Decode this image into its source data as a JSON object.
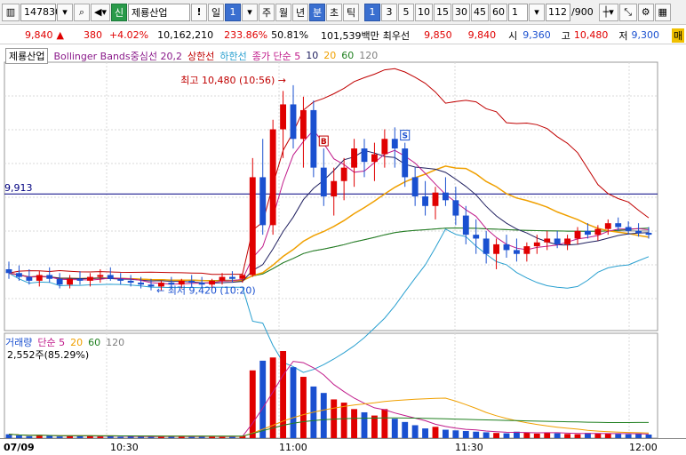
{
  "toolbar": {
    "code": "147830",
    "credit_badge": "신",
    "stock_name": "제룡산업",
    "exclaim": "!",
    "period_day": "일",
    "period_num": "1",
    "week": "주",
    "month": "월",
    "year": "년",
    "minute": "분",
    "second": "초",
    "tick": "틱",
    "intervals": [
      "1",
      "3",
      "5",
      "10",
      "15",
      "30",
      "45",
      "60"
    ],
    "active_interval": "1",
    "custom_interval": "1",
    "count": "112",
    "count_total": "/900"
  },
  "info": {
    "price": "9,840",
    "arrow": "▲",
    "change": "380",
    "change_pct": "+4.02%",
    "volume": "10,162,210",
    "vol_ratio": "233.86%",
    "strength": "50.81%",
    "amount": "101,539백만",
    "best_ask_label": "최우선",
    "best_ask": "9,850",
    "best_bid": "9,840",
    "open_label": "시",
    "open": "9,360",
    "high_label": "고",
    "high": "10,480",
    "low_label": "저",
    "low": "9,300",
    "more": "매"
  },
  "price_legend": {
    "name": "제룡산업",
    "bb": "Bollinger Bands중심선 20,2",
    "upper": "상한선",
    "lower": "하한선",
    "ma_label": "종가 단순 5",
    "ma10": "10",
    "ma20": "20",
    "ma60": "60",
    "ma120": "120"
  },
  "annotations": {
    "high": "최고 10,480 (10:56)",
    "low": "최저 9,420 (10:20)",
    "hline": "9,913",
    "buy": "B",
    "sell": "S"
  },
  "volume_legend": {
    "name": "거래량",
    "ma_label": "단순 5",
    "ma20": "20",
    "ma60": "60",
    "ma120": "120",
    "value": "2,552주(85.29%)"
  },
  "xaxis": {
    "date": "07/09",
    "ticks": [
      "10:30",
      "11:00",
      "11:30",
      "12:00"
    ]
  },
  "colors": {
    "up": "#e00000",
    "down": "#1a50d0",
    "bb_upper": "#c00000",
    "bb_lower": "#2aa0d0",
    "bb_mid": "#8a1a8a",
    "ma5": "#c01a8a",
    "ma10": "#202060",
    "ma20": "#f0a000",
    "ma60": "#208020",
    "ma120": "#808080"
  },
  "chart_data": {
    "type": "candlestick",
    "price_range": [
      9200,
      10600
    ],
    "hline": 9913,
    "candles": [
      [
        9520,
        9560,
        9470,
        9500
      ],
      [
        9500,
        9540,
        9460,
        9480
      ],
      [
        9480,
        9520,
        9440,
        9460
      ],
      [
        9460,
        9510,
        9430,
        9490
      ],
      [
        9490,
        9530,
        9450,
        9470
      ],
      [
        9470,
        9500,
        9420,
        9440
      ],
      [
        9440,
        9490,
        9420,
        9470
      ],
      [
        9470,
        9510,
        9440,
        9460
      ],
      [
        9460,
        9500,
        9430,
        9480
      ],
      [
        9480,
        9520,
        9450,
        9490
      ],
      [
        9490,
        9530,
        9460,
        9470
      ],
      [
        9470,
        9500,
        9440,
        9460
      ],
      [
        9460,
        9490,
        9430,
        9450
      ],
      [
        9450,
        9480,
        9420,
        9440
      ],
      [
        9440,
        9470,
        9410,
        9430
      ],
      [
        9430,
        9460,
        9410,
        9450
      ],
      [
        9450,
        9480,
        9420,
        9440
      ],
      [
        9440,
        9470,
        9420,
        9460
      ],
      [
        9460,
        9490,
        9430,
        9450
      ],
      [
        9450,
        9480,
        9420,
        9440
      ],
      [
        9440,
        9470,
        9420,
        9460
      ],
      [
        9460,
        9500,
        9440,
        9480
      ],
      [
        9480,
        9510,
        9450,
        9470
      ],
      [
        9470,
        9500,
        9450,
        9490
      ],
      [
        9490,
        10100,
        9480,
        10000
      ],
      [
        10000,
        10200,
        9700,
        9750
      ],
      [
        9750,
        10300,
        9700,
        10250
      ],
      [
        10250,
        10450,
        10100,
        10380
      ],
      [
        10380,
        10480,
        10150,
        10200
      ],
      [
        10200,
        10420,
        10050,
        10350
      ],
      [
        10350,
        10400,
        10000,
        10050
      ],
      [
        10050,
        10150,
        9850,
        9900
      ],
      [
        9900,
        10050,
        9800,
        9980
      ],
      [
        9980,
        10100,
        9880,
        10050
      ],
      [
        10050,
        10200,
        9950,
        10150
      ],
      [
        10150,
        10200,
        10000,
        10080
      ],
      [
        10080,
        10180,
        9980,
        10120
      ],
      [
        10120,
        10250,
        10050,
        10200
      ],
      [
        10200,
        10260,
        10050,
        10150
      ],
      [
        10150,
        10180,
        9950,
        10000
      ],
      [
        10000,
        10050,
        9850,
        9900
      ],
      [
        9900,
        9980,
        9800,
        9850
      ],
      [
        9850,
        9950,
        9780,
        9920
      ],
      [
        9920,
        10000,
        9850,
        9880
      ],
      [
        9880,
        9950,
        9750,
        9800
      ],
      [
        9800,
        9850,
        9650,
        9700
      ],
      [
        9700,
        9780,
        9600,
        9680
      ],
      [
        9680,
        9720,
        9550,
        9600
      ],
      [
        9600,
        9680,
        9520,
        9650
      ],
      [
        9650,
        9700,
        9580,
        9620
      ],
      [
        9620,
        9680,
        9560,
        9600
      ],
      [
        9600,
        9660,
        9560,
        9640
      ],
      [
        9640,
        9700,
        9600,
        9660
      ],
      [
        9660,
        9720,
        9620,
        9680
      ],
      [
        9680,
        9720,
        9630,
        9650
      ],
      [
        9650,
        9700,
        9620,
        9680
      ],
      [
        9680,
        9740,
        9650,
        9720
      ],
      [
        9720,
        9760,
        9680,
        9700
      ],
      [
        9700,
        9750,
        9670,
        9730
      ],
      [
        9730,
        9780,
        9700,
        9760
      ],
      [
        9760,
        9790,
        9720,
        9740
      ],
      [
        9740,
        9770,
        9700,
        9720
      ],
      [
        9720,
        9760,
        9690,
        9710
      ],
      [
        9710,
        9740,
        9680,
        9700
      ]
    ],
    "volumes": [
      120,
      80,
      60,
      90,
      70,
      50,
      60,
      70,
      80,
      50,
      60,
      40,
      50,
      60,
      40,
      50,
      60,
      50,
      40,
      60,
      50,
      40,
      60,
      70,
      2100,
      2400,
      2500,
      2700,
      2200,
      1900,
      1600,
      1400,
      1200,
      1100,
      900,
      800,
      700,
      900,
      600,
      500,
      400,
      300,
      350,
      260,
      240,
      220,
      200,
      180,
      160,
      150,
      200,
      180,
      140,
      170,
      150,
      130,
      120,
      160,
      150,
      140,
      130,
      120,
      140,
      110
    ]
  }
}
